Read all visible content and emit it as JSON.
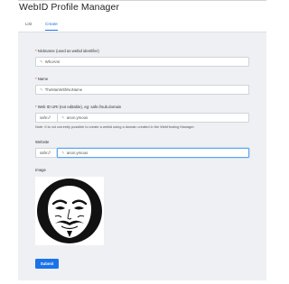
{
  "app": {
    "title": "WebID Profile Manager"
  },
  "tabs": [
    {
      "label": "List",
      "active": false
    },
    {
      "label": "Create",
      "active": true
    }
  ],
  "form": {
    "nickname": {
      "label": "Nickname (used as webid identifier)",
      "required": true,
      "value": "WhoAmI",
      "icon": "pencil-icon"
    },
    "name": {
      "label": "Name",
      "required": true,
      "value": "TheManWithNoName",
      "icon": "pencil-icon"
    },
    "webid_uri": {
      "label": "Web ID URI (not editable), eg: safe://sub.domain",
      "required": true,
      "prefix": "safe://",
      "value": "anon.ymous",
      "icon": "pencil-icon"
    },
    "note": "Note: It is not currently possible to create a webid using a domain created in the WebHosting Manager.",
    "website": {
      "label": "Website",
      "required": false,
      "prefix": "safe://",
      "value": "anon.ymous",
      "icon": "pencil-icon"
    },
    "image": {
      "label": "Image",
      "alt": "Guy Fawkes mask avatar"
    },
    "submit_label": "Submit"
  },
  "colors": {
    "accent": "#1a73e8",
    "required": "#d93025",
    "panel_bg": "#eef0f3"
  }
}
